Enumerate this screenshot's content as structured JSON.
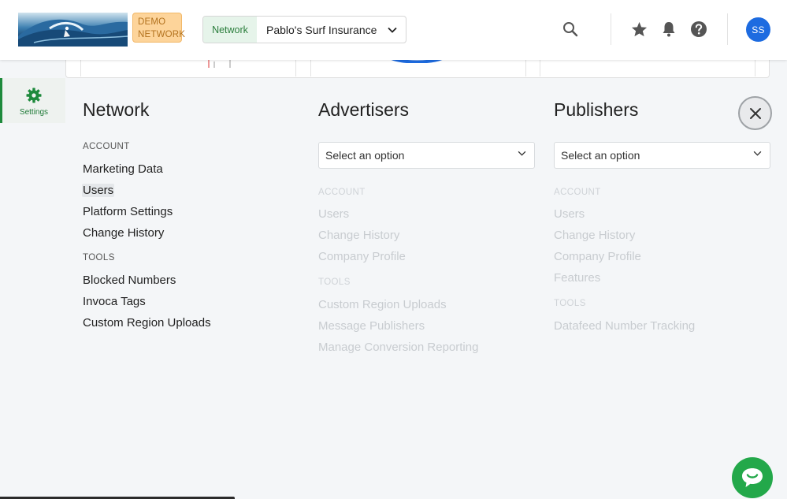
{
  "header": {
    "badge_line1": "DEMO",
    "badge_line2": "NETWORK",
    "network_tag": "Network",
    "network_value": "Pablo's Surf Insurance",
    "avatar_initials": "SS",
    "icons": [
      "search-icon",
      "star-icon",
      "bell-icon",
      "help-icon"
    ]
  },
  "rail": {
    "settings_label": "Settings"
  },
  "network": {
    "title": "Network",
    "sections": [
      {
        "label": "ACCOUNT",
        "items": [
          "Marketing Data",
          "Users",
          "Platform Settings",
          "Change History"
        ]
      },
      {
        "label": "TOOLS",
        "items": [
          "Blocked Numbers",
          "Invoca Tags",
          "Custom Region Uploads"
        ]
      }
    ],
    "highlighted_item": "Users"
  },
  "advertisers": {
    "title": "Advertisers",
    "select_placeholder": "Select an option",
    "sections": [
      {
        "label": "ACCOUNT",
        "items": [
          "Users",
          "Change History",
          "Company Profile"
        ]
      },
      {
        "label": "TOOLS",
        "items": [
          "Custom Region Uploads",
          "Message Publishers",
          "Manage Conversion Reporting"
        ]
      }
    ]
  },
  "publishers": {
    "title": "Publishers",
    "select_placeholder": "Select an option",
    "sections": [
      {
        "label": "ACCOUNT",
        "items": [
          "Users",
          "Change History",
          "Company Profile",
          "Features"
        ]
      },
      {
        "label": "TOOLS",
        "items": [
          "Datafeed Number Tracking"
        ]
      }
    ]
  },
  "colors": {
    "accent_green": "#1e8a3c",
    "avatar_blue": "#1d6be0",
    "demo_badge_bg": "#fdd49a",
    "chat_green": "#23a84a"
  }
}
